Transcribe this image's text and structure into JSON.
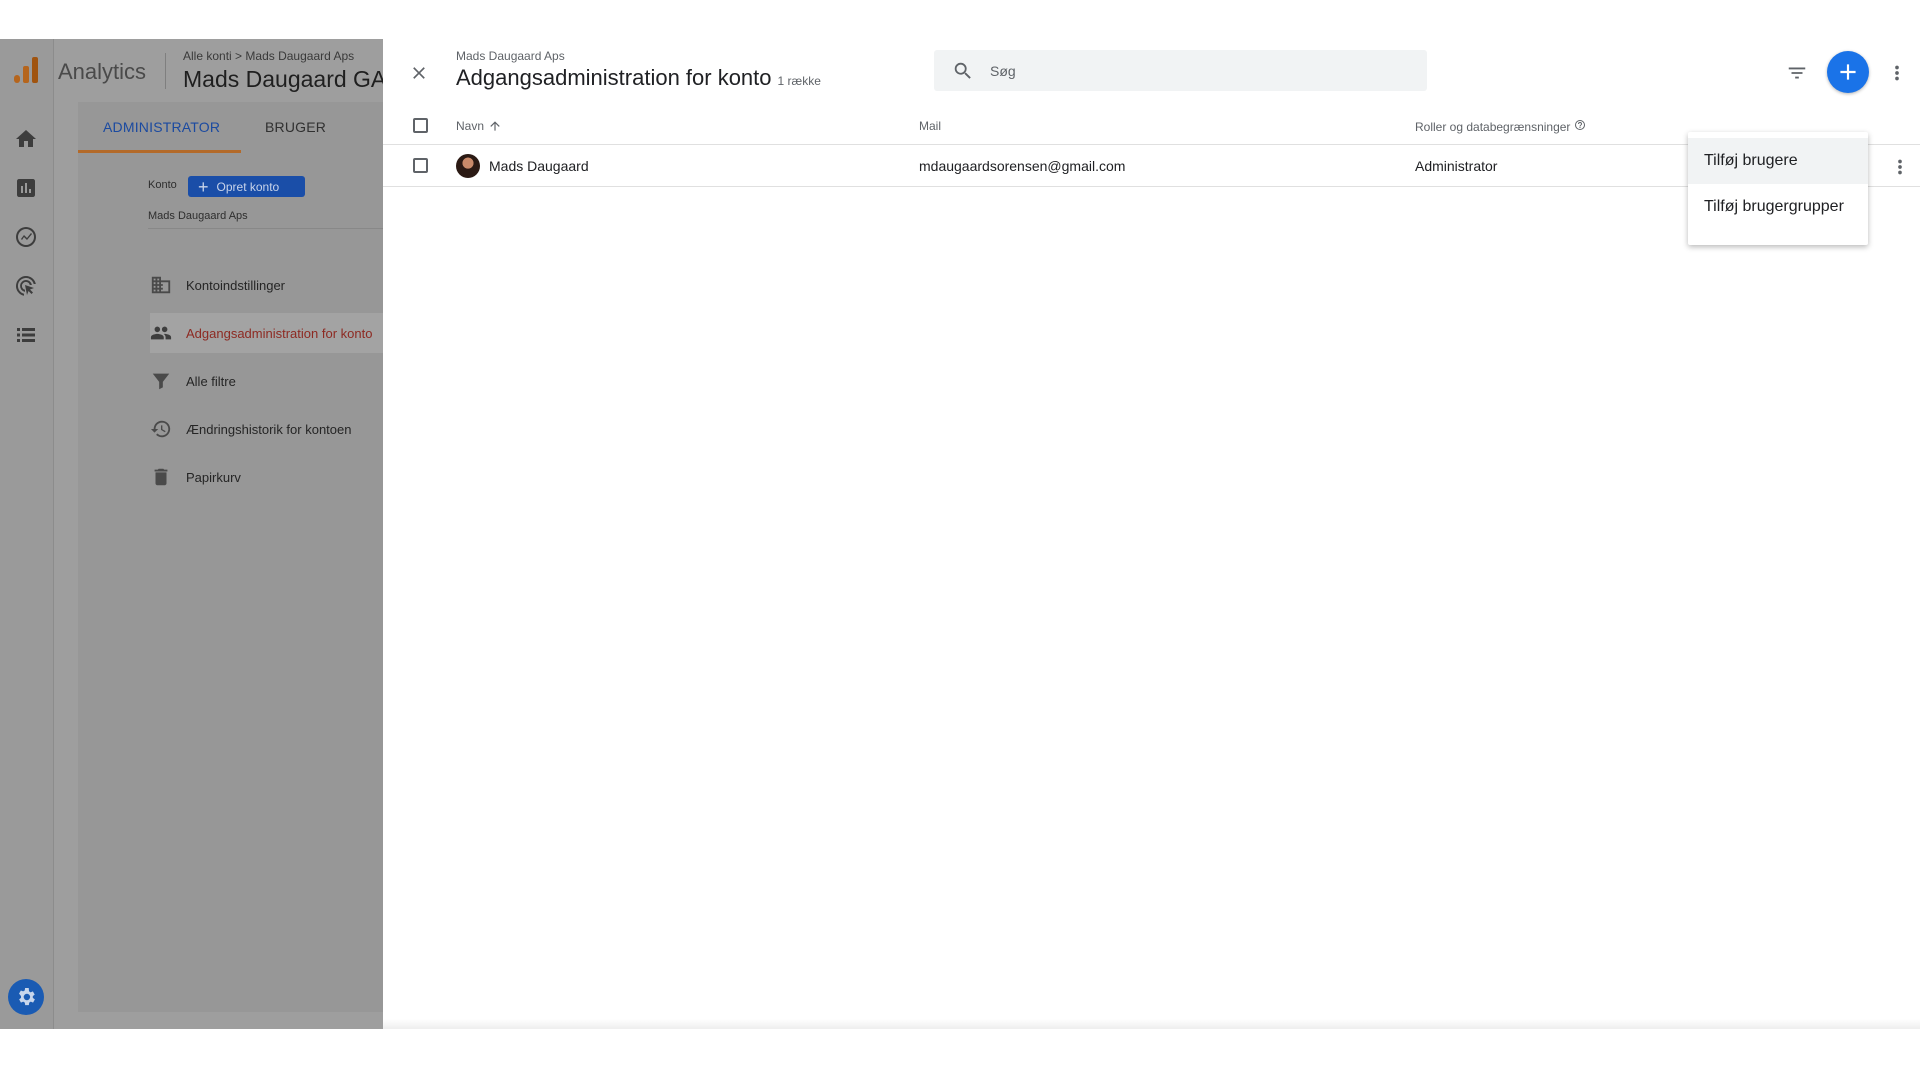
{
  "app": {
    "name": "Analytics",
    "breadcrumb_root": "Alle konti",
    "breadcrumb_sep": ">",
    "breadcrumb_account": "Mads Daugaard Aps",
    "account_title": "Mads Daugaard GA"
  },
  "admin_panel": {
    "tabs": [
      {
        "label": "ADMINISTRATOR",
        "active": true
      },
      {
        "label": "BRUGER",
        "active": false
      }
    ],
    "konto_label": "Konto",
    "create_account_label": "Opret konto",
    "account_name": "Mads Daugaard Aps",
    "menu": [
      {
        "label": "Kontoindstillinger",
        "icon": "building-icon",
        "active": false
      },
      {
        "label": "Adgangsadministration for konto",
        "icon": "people-icon",
        "active": true
      },
      {
        "label": "Alle filtre",
        "icon": "filter-icon",
        "active": false
      },
      {
        "label": "Ændringshistorik for kontoen",
        "icon": "history-icon",
        "active": false
      },
      {
        "label": "Papirkurv",
        "icon": "trash-icon",
        "active": false
      }
    ]
  },
  "nav_rail": {
    "icons": [
      "home-icon",
      "reports-icon",
      "explore-icon",
      "advertising-icon",
      "list-icon"
    ],
    "settings_icon": "gear-icon"
  },
  "sheet": {
    "account": "Mads Daugaard Aps",
    "title": "Adgangsadministration for konto",
    "row_count": "1 række",
    "search_placeholder": "Søg",
    "columns": {
      "name": "Navn",
      "mail": "Mail",
      "roles": "Roller og databegrænsninger"
    },
    "rows": [
      {
        "name": "Mads Daugaard",
        "mail": "mdaugaardsorensen@gmail.com",
        "role": "Administrator"
      }
    ]
  },
  "dropdown": {
    "items": [
      "Tilføj brugere",
      "Tilføj brugergrupper"
    ]
  },
  "colors": {
    "accent": "#1a73e8",
    "overlay": "#9e9e9e"
  }
}
